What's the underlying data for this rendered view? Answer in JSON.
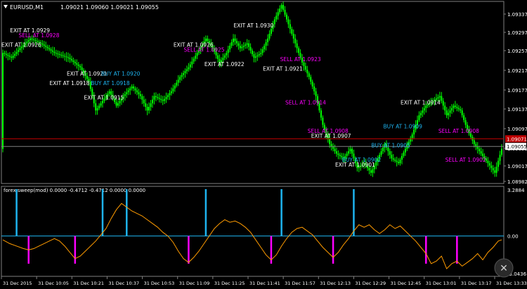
{
  "header": {
    "symbol_timeframe": "EURUSD,M1",
    "ohlc": "1.09021 1.09060 1.09021 1.09055"
  },
  "indicator": {
    "title": "forex sweep(mod) 0.0000 -0.4712 -0.4712 0.0000 0.0000",
    "price_top": "3.2884",
    "price_zero": "0.00",
    "price_bottom": "-3.0436"
  },
  "colors": {
    "background": "#000000",
    "frame": "#808080",
    "candle": "#00ff00",
    "exit_label": "#ffffff",
    "sell_label": "#ff00ff",
    "buy_label": "#1eb4f0",
    "osc_line": "#ff9b00",
    "osc_up_bar": "#1eb4f0",
    "osc_down_bar": "#ff00ff",
    "zero_line": "#1eb4f0",
    "bid_line": "#c00000",
    "ask_line": "#808080"
  },
  "chart_data": {
    "type": "candlestick",
    "symbol": "EURUSD",
    "timeframe": "M1",
    "ylim": [
      1.08982,
      1.09337
    ],
    "y_ticks": [
      "1.09337",
      "1.09297",
      "1.09257",
      "1.09217",
      "1.09177",
      "1.09137",
      "1.09097",
      "1.09055",
      "1.09017",
      "1.08982"
    ],
    "x_ticks": [
      "31 Dec 2015",
      "31 Dec 10:05",
      "31 Dec 10:21",
      "31 Dec 10:37",
      "31 Dec 10:53",
      "31 Dec 11:09",
      "31 Dec 11:25",
      "31 Dec 11:41",
      "31 Dec 11:57",
      "31 Dec 12:13",
      "31 Dec 12:29",
      "31 Dec 12:45",
      "31 Dec 13:01",
      "31 Dec 13:17",
      "31 Dec 13:33"
    ],
    "price_markers": [
      {
        "label": "1.09071",
        "value": 1.09071,
        "style": "bid"
      },
      {
        "label": "1.09055",
        "value": 1.09055,
        "style": "ask"
      }
    ],
    "close_path": [
      [
        0,
        1.0925
      ],
      [
        5,
        1.0924
      ],
      [
        10,
        1.0926
      ],
      [
        16,
        1.0928
      ],
      [
        22,
        1.0927
      ],
      [
        30,
        1.0925
      ],
      [
        38,
        1.0924
      ],
      [
        45,
        1.0922
      ],
      [
        50,
        1.0919
      ],
      [
        54,
        1.0913
      ],
      [
        58,
        1.0915
      ],
      [
        62,
        1.0917
      ],
      [
        66,
        1.0914
      ],
      [
        70,
        1.0916
      ],
      [
        75,
        1.0918
      ],
      [
        80,
        1.0916
      ],
      [
        84,
        1.0913
      ],
      [
        88,
        1.0916
      ],
      [
        93,
        1.0915
      ],
      [
        98,
        1.0917
      ],
      [
        103,
        1.092
      ],
      [
        108,
        1.0922
      ],
      [
        113,
        1.0925
      ],
      [
        118,
        1.0928
      ],
      [
        122,
        1.0926
      ],
      [
        126,
        1.0923
      ],
      [
        130,
        1.0925
      ],
      [
        134,
        1.0928
      ],
      [
        138,
        1.0926
      ],
      [
        142,
        1.0927
      ],
      [
        146,
        1.0924
      ],
      [
        150,
        1.0925
      ],
      [
        154,
        1.0928
      ],
      [
        158,
        1.0932
      ],
      [
        162,
        1.0935
      ],
      [
        166,
        1.0931
      ],
      [
        170,
        1.0927
      ],
      [
        174,
        1.0923
      ],
      [
        178,
        1.092
      ],
      [
        182,
        1.0916
      ],
      [
        186,
        1.091
      ],
      [
        190,
        1.0906
      ],
      [
        194,
        1.0904
      ],
      [
        198,
        1.0903
      ],
      [
        202,
        1.0905
      ],
      [
        206,
        1.0901
      ],
      [
        210,
        1.0902
      ],
      [
        214,
        1.09
      ],
      [
        218,
        1.0903
      ],
      [
        222,
        1.0906
      ],
      [
        226,
        1.0903
      ],
      [
        230,
        1.0902
      ],
      [
        234,
        1.0905
      ],
      [
        238,
        1.0908
      ],
      [
        242,
        1.0912
      ],
      [
        246,
        1.0914
      ],
      [
        250,
        1.0915
      ],
      [
        254,
        1.0916
      ],
      [
        258,
        1.0912
      ],
      [
        262,
        1.0914
      ],
      [
        266,
        1.0913
      ],
      [
        270,
        1.0909
      ],
      [
        274,
        1.0906
      ],
      [
        278,
        1.0904
      ],
      [
        282,
        1.0902
      ],
      [
        286,
        1.09
      ],
      [
        290,
        1.0905
      ]
    ],
    "close_path_note_bars": 290,
    "signals": [
      {
        "text": "EXIT AT 1.0929",
        "kind": "exit",
        "bar": 5,
        "price": 1.0929
      },
      {
        "text": "SELL AT 1.0928",
        "kind": "sell",
        "bar": 10,
        "price": 1.0928
      },
      {
        "text": "EXIT AT 1.0926",
        "kind": "exit",
        "bar": 0,
        "price": 1.0926
      },
      {
        "text": "EXIT AT 1.0920",
        "kind": "exit",
        "bar": 38,
        "price": 1.092
      },
      {
        "text": "EXIT AT 1.0918",
        "kind": "exit",
        "bar": 28,
        "price": 1.0918
      },
      {
        "text": "BUY AT 1.0920",
        "kind": "buy",
        "bar": 58,
        "price": 1.092
      },
      {
        "text": "BUY AT 1.0918",
        "kind": "buy",
        "bar": 52,
        "price": 1.0918
      },
      {
        "text": "EXIT AT 1.0915",
        "kind": "exit",
        "bar": 48,
        "price": 1.0915
      },
      {
        "text": "EXIT AT 1.0930",
        "kind": "exit",
        "bar": 135,
        "price": 1.093
      },
      {
        "text": "EXIT AT 1.0926",
        "kind": "exit",
        "bar": 100,
        "price": 1.0926
      },
      {
        "text": "SELL AT 1.0925",
        "kind": "sell",
        "bar": 106,
        "price": 1.0925
      },
      {
        "text": "EXIT AT 1.0922",
        "kind": "exit",
        "bar": 118,
        "price": 1.0922
      },
      {
        "text": "SELL AT 1.0923",
        "kind": "sell",
        "bar": 162,
        "price": 1.0923
      },
      {
        "text": "EXIT AT 1.0921",
        "kind": "exit",
        "bar": 152,
        "price": 1.0921
      },
      {
        "text": "SELL AT 1.0914",
        "kind": "sell",
        "bar": 165,
        "price": 1.0914
      },
      {
        "text": "SELL AT 1.0908",
        "kind": "sell",
        "bar": 178,
        "price": 1.0908
      },
      {
        "text": "EXIT AT 1.0907",
        "kind": "exit",
        "bar": 180,
        "price": 1.0907
      },
      {
        "text": "BUY AT 1.0905",
        "kind": "buy",
        "bar": 215,
        "price": 1.0905
      },
      {
        "text": "BUY AT 1.0909",
        "kind": "buy",
        "bar": 222,
        "price": 1.0909
      },
      {
        "text": "EXIT AT 1.0914",
        "kind": "exit",
        "bar": 232,
        "price": 1.0914
      },
      {
        "text": "BUY AT 1.0902",
        "kind": "buy",
        "bar": 198,
        "price": 1.0902
      },
      {
        "text": "EXIT AT 1.0901",
        "kind": "exit",
        "bar": 194,
        "price": 1.0901
      },
      {
        "text": "SELL AT 1.0908",
        "kind": "sell",
        "bar": 254,
        "price": 1.0908
      },
      {
        "text": "SELL AT 1.0902",
        "kind": "sell",
        "bar": 258,
        "price": 1.0902
      }
    ],
    "oscillator": {
      "name": "forex sweep(mod)",
      "ylim": [
        -3.0436,
        3.2884
      ],
      "zero_level": 0.0,
      "line": [
        [
          0,
          -0.3
        ],
        [
          4,
          -0.6
        ],
        [
          8,
          -0.8
        ],
        [
          12,
          -1.0
        ],
        [
          15,
          -1.1
        ],
        [
          18,
          -1.0
        ],
        [
          21,
          -0.8
        ],
        [
          24,
          -0.6
        ],
        [
          27,
          -0.4
        ],
        [
          30,
          -0.2
        ],
        [
          33,
          -0.4
        ],
        [
          36,
          -0.8
        ],
        [
          39,
          -1.3
        ],
        [
          42,
          -1.8
        ],
        [
          45,
          -1.6
        ],
        [
          48,
          -1.2
        ],
        [
          51,
          -0.8
        ],
        [
          54,
          -0.4
        ],
        [
          57,
          0.1
        ],
        [
          60,
          0.6
        ],
        [
          63,
          1.4
        ],
        [
          66,
          2.1
        ],
        [
          69,
          2.6
        ],
        [
          72,
          2.3
        ],
        [
          75,
          2.0
        ],
        [
          78,
          1.8
        ],
        [
          81,
          1.6
        ],
        [
          84,
          1.3
        ],
        [
          87,
          1.0
        ],
        [
          90,
          0.7
        ],
        [
          93,
          0.3
        ],
        [
          96,
          0.0
        ],
        [
          99,
          -0.5
        ],
        [
          102,
          -1.2
        ],
        [
          105,
          -1.8
        ],
        [
          108,
          -2.1
        ],
        [
          111,
          -1.7
        ],
        [
          114,
          -1.2
        ],
        [
          117,
          -0.6
        ],
        [
          120,
          0.0
        ],
        [
          123,
          0.6
        ],
        [
          126,
          1.0
        ],
        [
          129,
          1.3
        ],
        [
          132,
          1.1
        ],
        [
          135,
          1.2
        ],
        [
          138,
          1.0
        ],
        [
          141,
          0.7
        ],
        [
          144,
          0.3
        ],
        [
          147,
          -0.3
        ],
        [
          150,
          -0.9
        ],
        [
          153,
          -1.5
        ],
        [
          156,
          -1.9
        ],
        [
          159,
          -1.5
        ],
        [
          162,
          -0.8
        ],
        [
          165,
          -0.2
        ],
        [
          168,
          0.3
        ],
        [
          171,
          0.6
        ],
        [
          174,
          0.7
        ],
        [
          177,
          0.4
        ],
        [
          180,
          0.1
        ],
        [
          183,
          -0.4
        ],
        [
          186,
          -0.9
        ],
        [
          189,
          -1.3
        ],
        [
          192,
          -1.7
        ],
        [
          195,
          -1.3
        ],
        [
          198,
          -0.7
        ],
        [
          201,
          -0.2
        ],
        [
          204,
          0.4
        ],
        [
          207,
          0.9
        ],
        [
          210,
          0.7
        ],
        [
          213,
          0.9
        ],
        [
          216,
          0.5
        ],
        [
          219,
          0.2
        ],
        [
          222,
          0.5
        ],
        [
          225,
          0.9
        ],
        [
          228,
          0.6
        ],
        [
          231,
          0.8
        ],
        [
          234,
          0.4
        ],
        [
          237,
          0.0
        ],
        [
          240,
          -0.4
        ],
        [
          243,
          -0.9
        ],
        [
          246,
          -1.4
        ],
        [
          249,
          -2.2
        ],
        [
          252,
          -2.0
        ],
        [
          255,
          -1.6
        ],
        [
          258,
          -2.6
        ],
        [
          261,
          -2.2
        ],
        [
          264,
          -2.0
        ],
        [
          267,
          -2.4
        ],
        [
          270,
          -2.1
        ],
        [
          273,
          -1.8
        ],
        [
          276,
          -1.4
        ],
        [
          279,
          -1.9
        ],
        [
          282,
          -1.3
        ],
        [
          285,
          -0.9
        ],
        [
          288,
          -0.4
        ],
        [
          290,
          -0.3
        ]
      ],
      "up_bars": [
        8,
        58,
        72,
        118,
        162,
        204
      ],
      "down_bars": [
        15,
        42,
        108,
        156,
        192,
        246,
        264
      ]
    }
  }
}
